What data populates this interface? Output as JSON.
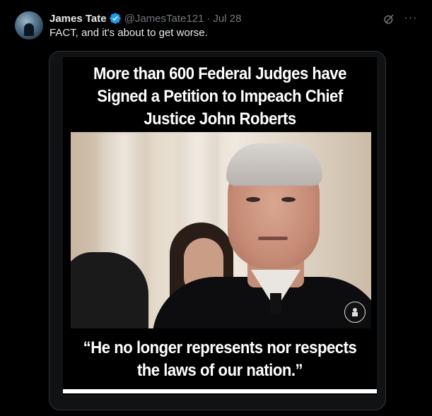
{
  "tweet": {
    "display_name": "James Tate",
    "handle": "@JamesTate121",
    "separator": "·",
    "date": "Jul 28",
    "text": "FACT, and it's about to get worse.",
    "verified": true,
    "verified_color": "#1d9bf0"
  },
  "icons": {
    "avatar": "avatar-photo",
    "verified": "verified-badge-icon",
    "grok": "grok-icon",
    "more": "more-options-icon",
    "more_glyph": "···"
  },
  "meme": {
    "headline": "More than 600 Federal Judges have Signed a Petition to Impeach Chief Justice John Roberts",
    "quote": "“He no longer represents nor respects the laws of our nation.”"
  }
}
